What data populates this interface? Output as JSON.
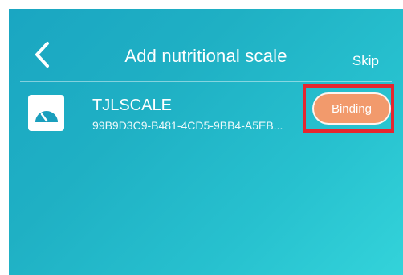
{
  "nav": {
    "back_icon": "chevron-left-icon",
    "title": "Add nutritional scale",
    "skip_label": "Skip"
  },
  "device": {
    "icon": "scale-icon",
    "name": "TJLSCALE",
    "id": "99B9D3C9-B481-4CD5-9BB4-A5EB...",
    "binding_label": "Binding"
  },
  "colors": {
    "gradient_start": "#1aa6c2",
    "gradient_end": "#33d3da",
    "button": "#f29a6c",
    "highlight": "#e5262f"
  }
}
